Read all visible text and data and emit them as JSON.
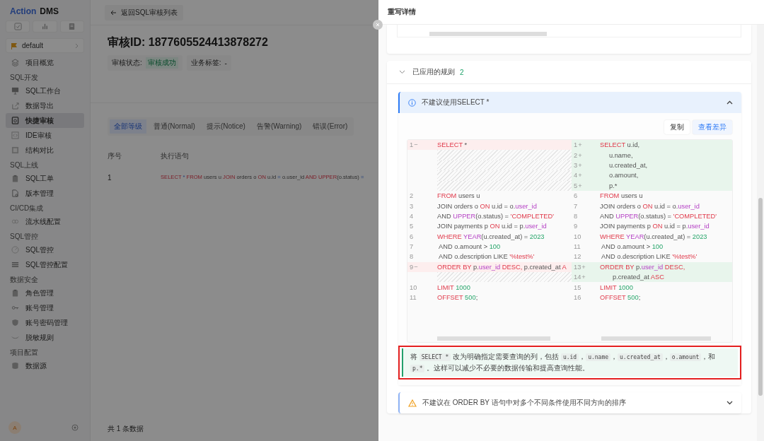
{
  "sidebar": {
    "logo": {
      "brand": "Action",
      "product": "DMS"
    },
    "project": "default",
    "groups": [
      {
        "items": [
          {
            "label": "项目概览",
            "selected": false
          }
        ]
      },
      {
        "title": "SQL开发",
        "items": [
          {
            "label": "SQL工作台",
            "selected": false
          },
          {
            "label": "数据导出",
            "selected": false
          },
          {
            "label": "快捷审核",
            "selected": true
          },
          {
            "label": "IDE审核",
            "selected": false
          },
          {
            "label": "结构对比",
            "selected": false
          }
        ]
      },
      {
        "title": "SQL上线",
        "items": [
          {
            "label": "SQL工单",
            "selected": false
          },
          {
            "label": "版本管理",
            "selected": false
          }
        ]
      },
      {
        "title": "CI/CD集成",
        "items": [
          {
            "label": "流水线配置",
            "selected": false
          }
        ]
      },
      {
        "title": "SQL管控",
        "items": [
          {
            "label": "SQL管控",
            "selected": false
          },
          {
            "label": "SQL管控配置",
            "selected": false
          }
        ]
      },
      {
        "title": "数据安全",
        "items": [
          {
            "label": "角色管理",
            "selected": false
          },
          {
            "label": "账号管理",
            "selected": false
          },
          {
            "label": "账号密码管理",
            "selected": false
          },
          {
            "label": "脱敏规则",
            "selected": false
          }
        ]
      },
      {
        "title": "项目配置",
        "items": [
          {
            "label": "数据源",
            "selected": false
          }
        ]
      }
    ],
    "avatar": "A"
  },
  "main": {
    "back": "返回SQL审核列表",
    "title": "审核ID: 1877605524413878272",
    "status_label": "审核状态:",
    "status": "审核成功",
    "tag_label": "业务标签:",
    "tag_value": "-",
    "tabs": [
      {
        "label": "全部等级",
        "selected": true
      },
      {
        "label": "普通(Normal)",
        "selected": false
      },
      {
        "label": "提示(Notice)",
        "selected": false
      },
      {
        "label": "告警(Warning)",
        "selected": false
      },
      {
        "label": "错误(Error)",
        "selected": false
      }
    ],
    "table": {
      "columns": [
        "序号",
        "执行语句"
      ],
      "rows": [
        {
          "index": "1",
          "sql": [
            {
              "t": "SELECT",
              "kind": "kw"
            },
            {
              "t": " * ",
              "kind": "op"
            },
            {
              "t": "FROM",
              "kind": "kw"
            },
            {
              "t": " users u ",
              "kind": "plain"
            },
            {
              "t": "JOIN",
              "kind": "kw"
            },
            {
              "t": " orders o ",
              "kind": "plain"
            },
            {
              "t": "ON",
              "kind": "kw"
            },
            {
              "t": " u.id ",
              "kind": "plain"
            },
            {
              "t": "=",
              "kind": "op"
            },
            {
              "t": " o.user_id ",
              "kind": "plain"
            },
            {
              "t": "AND UPPER",
              "kind": "kw"
            },
            {
              "t": "(o.status) ",
              "kind": "plain"
            },
            {
              "t": "=",
              "kind": "op"
            }
          ]
        }
      ]
    },
    "footer": "共 1 条数据"
  },
  "drawer": {
    "title": "重写详情",
    "rules_section": {
      "title": "已应用的规则",
      "count": "2",
      "expanded": true
    },
    "rules": [
      {
        "kind": "info",
        "title": "不建议使用SELECT *",
        "expanded": true,
        "actions": [
          "复制",
          "查看差异"
        ],
        "diff": [
          {
            "left": {
              "number": "1",
              "marker": "−",
              "kind": "removed",
              "tokens": [
                {
                  "t": "SELECT",
                  "kind": "kw"
                },
                {
                  "t": " *",
                  "kind": "plain"
                }
              ]
            },
            "right": {
              "number": "1",
              "marker": "+",
              "kind": "added",
              "tokens": [
                {
                  "t": "SELECT",
                  "kind": "kw"
                },
                {
                  "t": " u.id,",
                  "kind": "plain"
                }
              ]
            }
          },
          {
            "left": {
              "kind": "filler"
            },
            "right": {
              "number": "2",
              "marker": "+",
              "kind": "added",
              "tokens": [
                {
                  "t": "     u.name,",
                  "kind": "plain"
                }
              ]
            }
          },
          {
            "left": {
              "kind": "filler"
            },
            "right": {
              "number": "3",
              "marker": "+",
              "kind": "added",
              "tokens": [
                {
                  "t": "     u.created_at,",
                  "kind": "plain"
                }
              ]
            }
          },
          {
            "left": {
              "kind": "filler"
            },
            "right": {
              "number": "4",
              "marker": "+",
              "kind": "added",
              "tokens": [
                {
                  "t": "     o.amount,",
                  "kind": "plain"
                }
              ]
            }
          },
          {
            "left": {
              "kind": "filler"
            },
            "right": {
              "number": "5",
              "marker": "+",
              "kind": "added",
              "tokens": [
                {
                  "t": "     p.*",
                  "kind": "plain"
                }
              ]
            }
          },
          {
            "left": {
              "number": "2",
              "kind": "same",
              "tokens": [
                {
                  "t": "FROM",
                  "kind": "kw"
                },
                {
                  "t": " users u",
                  "kind": "plain"
                }
              ]
            },
            "right": {
              "number": "6",
              "kind": "same",
              "tokens": [
                {
                  "t": "FROM",
                  "kind": "kw"
                },
                {
                  "t": " users u",
                  "kind": "plain"
                }
              ]
            }
          },
          {
            "left": {
              "number": "3",
              "kind": "same",
              "tokens": [
                {
                  "t": "JOIN orders o ",
                  "kind": "plain"
                },
                {
                  "t": "ON",
                  "kind": "kw"
                },
                {
                  "t": " u.id = o.",
                  "kind": "plain"
                },
                {
                  "t": "user_id",
                  "kind": "fn"
                }
              ]
            },
            "right": {
              "number": "7",
              "kind": "same",
              "tokens": [
                {
                  "t": "JOIN orders o ",
                  "kind": "plain"
                },
                {
                  "t": "ON",
                  "kind": "kw"
                },
                {
                  "t": " u.id = o.",
                  "kind": "plain"
                },
                {
                  "t": "user_id",
                  "kind": "fn"
                }
              ]
            }
          },
          {
            "left": {
              "number": "4",
              "kind": "same",
              "tokens": [
                {
                  "t": "AND ",
                  "kind": "plain"
                },
                {
                  "t": "UPPER",
                  "kind": "fn"
                },
                {
                  "t": "(o.status) = ",
                  "kind": "plain"
                },
                {
                  "t": "'COMPLETED'",
                  "kind": "kw"
                }
              ]
            },
            "right": {
              "number": "8",
              "kind": "same",
              "tokens": [
                {
                  "t": "AND ",
                  "kind": "plain"
                },
                {
                  "t": "UPPER",
                  "kind": "fn"
                },
                {
                  "t": "(o.status) = ",
                  "kind": "plain"
                },
                {
                  "t": "'COMPLETED'",
                  "kind": "kw"
                }
              ]
            }
          },
          {
            "left": {
              "number": "5",
              "kind": "same",
              "tokens": [
                {
                  "t": "JOIN payments p ",
                  "kind": "plain"
                },
                {
                  "t": "ON",
                  "kind": "kw"
                },
                {
                  "t": " u.id = p.",
                  "kind": "plain"
                },
                {
                  "t": "user_id",
                  "kind": "fn"
                }
              ]
            },
            "right": {
              "number": "9",
              "kind": "same",
              "tokens": [
                {
                  "t": "JOIN payments p ",
                  "kind": "plain"
                },
                {
                  "t": "ON",
                  "kind": "kw"
                },
                {
                  "t": " u.id = p.",
                  "kind": "plain"
                },
                {
                  "t": "user_id",
                  "kind": "fn"
                }
              ]
            }
          },
          {
            "left": {
              "number": "6",
              "kind": "same",
              "tokens": [
                {
                  "t": "WHERE ",
                  "kind": "kw"
                },
                {
                  "t": "YEAR",
                  "kind": "fn"
                },
                {
                  "t": "(u.created_at) = ",
                  "kind": "plain"
                },
                {
                  "t": "2023",
                  "kind": "num"
                }
              ]
            },
            "right": {
              "number": "10",
              "kind": "same",
              "tokens": [
                {
                  "t": "WHERE ",
                  "kind": "kw"
                },
                {
                  "t": "YEAR",
                  "kind": "fn"
                },
                {
                  "t": "(u.created_at) = ",
                  "kind": "plain"
                },
                {
                  "t": "2023",
                  "kind": "num"
                }
              ]
            }
          },
          {
            "left": {
              "number": "7",
              "kind": "same",
              "tokens": [
                {
                  "t": " AND o.amount > ",
                  "kind": "plain"
                },
                {
                  "t": "100",
                  "kind": "num"
                }
              ]
            },
            "right": {
              "number": "11",
              "kind": "same",
              "tokens": [
                {
                  "t": " AND o.amount > ",
                  "kind": "plain"
                },
                {
                  "t": "100",
                  "kind": "num"
                }
              ]
            }
          },
          {
            "left": {
              "number": "8",
              "kind": "same",
              "tokens": [
                {
                  "t": " AND o.description LIKE ",
                  "kind": "plain"
                },
                {
                  "t": "'%test%'",
                  "kind": "kw"
                }
              ]
            },
            "right": {
              "number": "12",
              "kind": "same",
              "tokens": [
                {
                  "t": " AND o.description LIKE ",
                  "kind": "plain"
                },
                {
                  "t": "'%test%'",
                  "kind": "kw"
                }
              ]
            }
          },
          {
            "left": {
              "number": "9",
              "marker": "−",
              "kind": "removed",
              "tokens": [
                {
                  "t": "ORDER BY",
                  "kind": "kw"
                },
                {
                  "t": " p.",
                  "kind": "plain"
                },
                {
                  "t": "user_id",
                  "kind": "fn"
                },
                {
                  "t": " DESC,",
                  "kind": "kw"
                },
                {
                  "t": " p.created_at ",
                  "kind": "plain"
                },
                {
                  "t": "A",
                  "kind": "kw"
                }
              ]
            },
            "right": {
              "number": "13",
              "marker": "+",
              "kind": "added",
              "tokens": [
                {
                  "t": "ORDER BY",
                  "kind": "kw"
                },
                {
                  "t": " p.",
                  "kind": "plain"
                },
                {
                  "t": "user_id",
                  "kind": "fn"
                },
                {
                  "t": " DESC,",
                  "kind": "kw"
                }
              ]
            }
          },
          {
            "left": {
              "kind": "filler"
            },
            "right": {
              "number": "14",
              "marker": "+",
              "kind": "added",
              "tokens": [
                {
                  "t": "       p.created_at ",
                  "kind": "plain"
                },
                {
                  "t": "ASC",
                  "kind": "kw"
                }
              ]
            }
          },
          {
            "left": {
              "number": "10",
              "kind": "same",
              "tokens": [
                {
                  "t": "LIMIT",
                  "kind": "kw"
                },
                {
                  "t": " 1000",
                  "kind": "num"
                }
              ]
            },
            "right": {
              "number": "15",
              "kind": "same",
              "tokens": [
                {
                  "t": "LIMIT",
                  "kind": "kw"
                },
                {
                  "t": " 1000",
                  "kind": "num"
                }
              ]
            }
          },
          {
            "left": {
              "number": "11",
              "kind": "same",
              "tokens": [
                {
                  "t": "OFFSET",
                  "kind": "kw"
                },
                {
                  "t": " 500",
                  "kind": "num"
                },
                {
                  "t": ";",
                  "kind": "plain"
                }
              ]
            },
            "right": {
              "number": "16",
              "kind": "same",
              "tokens": [
                {
                  "t": "OFFSET",
                  "kind": "kw"
                },
                {
                  "t": " 500",
                  "kind": "num"
                },
                {
                  "t": ";",
                  "kind": "plain"
                }
              ]
            }
          }
        ],
        "explanation": [
          {
            "t": "将 ",
            "kind": "text"
          },
          {
            "t": "SELECT *",
            "kind": "code"
          },
          {
            "t": " 改为明确指定需要查询的列，包括 ",
            "kind": "text"
          },
          {
            "t": "u.id",
            "kind": "code"
          },
          {
            "t": "，",
            "kind": "text"
          },
          {
            "t": "u.name",
            "kind": "code"
          },
          {
            "t": "，",
            "kind": "text"
          },
          {
            "t": "u.created_at",
            "kind": "code"
          },
          {
            "t": "，",
            "kind": "text"
          },
          {
            "t": "o.amount",
            "kind": "code"
          },
          {
            "t": "，和 ",
            "kind": "text"
          },
          {
            "t": "p.*",
            "kind": "code"
          },
          {
            "t": " 。这样可以减少不必要的数据传输和提高查询性能。",
            "kind": "text"
          }
        ]
      },
      {
        "kind": "warning",
        "title": "不建议在 ORDER BY 语句中对多个不同条件使用不同方向的排序",
        "expanded": false
      }
    ]
  }
}
